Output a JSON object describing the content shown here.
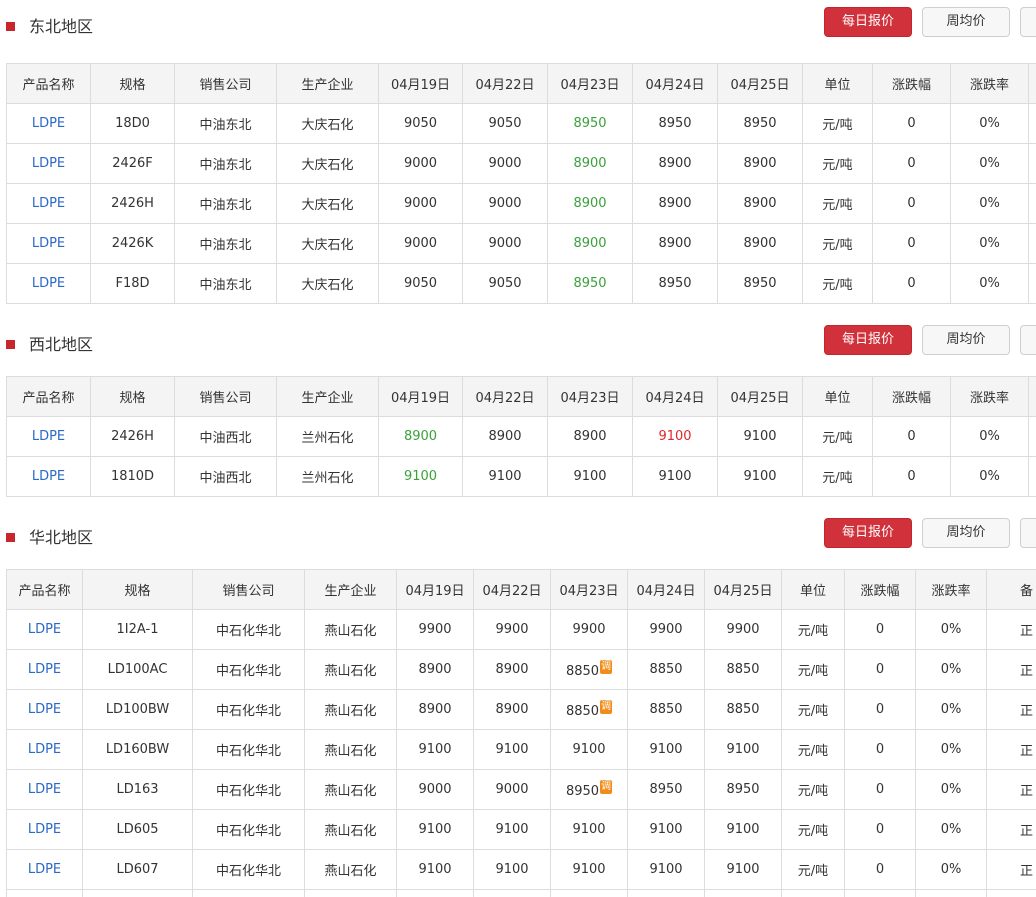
{
  "buttons": {
    "daily": "每日报价",
    "weekly": "周均价"
  },
  "colors": {
    "accent": "#c8262d",
    "link": "#2a68c9",
    "down": "#3aa13a",
    "up": "#e0272c",
    "badge": "#f08c1a"
  },
  "sections": [
    {
      "title": "东北地区",
      "headers": [
        "产品名称",
        "规格",
        "销售公司",
        "生产企业",
        "04月19日",
        "04月22日",
        "04月23日",
        "04月24日",
        "04月25日",
        "单位",
        "涨跌幅",
        "涨跌率"
      ],
      "rows": [
        [
          {
            "v": "LDPE"
          },
          {
            "v": "18D0"
          },
          {
            "v": "中油东北"
          },
          {
            "v": "大庆石化"
          },
          {
            "v": "9050"
          },
          {
            "v": "9050"
          },
          {
            "v": "8950",
            "c": "down"
          },
          {
            "v": "8950"
          },
          {
            "v": "8950"
          },
          {
            "v": "元/吨"
          },
          {
            "v": "0"
          },
          {
            "v": "0%"
          }
        ],
        [
          {
            "v": "LDPE"
          },
          {
            "v": "2426F"
          },
          {
            "v": "中油东北"
          },
          {
            "v": "大庆石化"
          },
          {
            "v": "9000"
          },
          {
            "v": "9000"
          },
          {
            "v": "8900",
            "c": "down"
          },
          {
            "v": "8900"
          },
          {
            "v": "8900"
          },
          {
            "v": "元/吨"
          },
          {
            "v": "0"
          },
          {
            "v": "0%"
          }
        ],
        [
          {
            "v": "LDPE"
          },
          {
            "v": "2426H"
          },
          {
            "v": "中油东北"
          },
          {
            "v": "大庆石化"
          },
          {
            "v": "9000"
          },
          {
            "v": "9000"
          },
          {
            "v": "8900",
            "c": "down"
          },
          {
            "v": "8900"
          },
          {
            "v": "8900"
          },
          {
            "v": "元/吨"
          },
          {
            "v": "0"
          },
          {
            "v": "0%"
          }
        ],
        [
          {
            "v": "LDPE"
          },
          {
            "v": "2426K"
          },
          {
            "v": "中油东北"
          },
          {
            "v": "大庆石化"
          },
          {
            "v": "9000"
          },
          {
            "v": "9000"
          },
          {
            "v": "8900",
            "c": "down"
          },
          {
            "v": "8900"
          },
          {
            "v": "8900"
          },
          {
            "v": "元/吨"
          },
          {
            "v": "0"
          },
          {
            "v": "0%"
          }
        ],
        [
          {
            "v": "LDPE"
          },
          {
            "v": "F18D"
          },
          {
            "v": "中油东北"
          },
          {
            "v": "大庆石化"
          },
          {
            "v": "9050"
          },
          {
            "v": "9050"
          },
          {
            "v": "8950",
            "c": "down"
          },
          {
            "v": "8950"
          },
          {
            "v": "8950"
          },
          {
            "v": "元/吨"
          },
          {
            "v": "0"
          },
          {
            "v": "0%"
          }
        ]
      ]
    },
    {
      "title": "西北地区",
      "headers": [
        "产品名称",
        "规格",
        "销售公司",
        "生产企业",
        "04月19日",
        "04月22日",
        "04月23日",
        "04月24日",
        "04月25日",
        "单位",
        "涨跌幅",
        "涨跌率"
      ],
      "rows": [
        [
          {
            "v": "LDPE"
          },
          {
            "v": "2426H"
          },
          {
            "v": "中油西北"
          },
          {
            "v": "兰州石化"
          },
          {
            "v": "8900",
            "c": "down"
          },
          {
            "v": "8900"
          },
          {
            "v": "8900"
          },
          {
            "v": "9100",
            "c": "up"
          },
          {
            "v": "9100"
          },
          {
            "v": "元/吨"
          },
          {
            "v": "0"
          },
          {
            "v": "0%"
          }
        ],
        [
          {
            "v": "LDPE"
          },
          {
            "v": "1810D"
          },
          {
            "v": "中油西北"
          },
          {
            "v": "兰州石化"
          },
          {
            "v": "9100",
            "c": "down"
          },
          {
            "v": "9100"
          },
          {
            "v": "9100"
          },
          {
            "v": "9100"
          },
          {
            "v": "9100"
          },
          {
            "v": "元/吨"
          },
          {
            "v": "0"
          },
          {
            "v": "0%"
          }
        ]
      ]
    },
    {
      "title": "华北地区",
      "headers": [
        "产品名称",
        "规格",
        "销售公司",
        "生产企业",
        "04月19日",
        "04月22日",
        "04月23日",
        "04月24日",
        "04月25日",
        "单位",
        "涨跌幅",
        "涨跌率",
        "备"
      ],
      "badge_text": "调",
      "rows": [
        [
          {
            "v": "LDPE"
          },
          {
            "v": "1I2A-1"
          },
          {
            "v": "中石化华北"
          },
          {
            "v": "燕山石化"
          },
          {
            "v": "9900"
          },
          {
            "v": "9900"
          },
          {
            "v": "9900"
          },
          {
            "v": "9900"
          },
          {
            "v": "9900"
          },
          {
            "v": "元/吨"
          },
          {
            "v": "0"
          },
          {
            "v": "0%"
          },
          {
            "v": "正"
          }
        ],
        [
          {
            "v": "LDPE"
          },
          {
            "v": "LD100AC"
          },
          {
            "v": "中石化华北"
          },
          {
            "v": "燕山石化"
          },
          {
            "v": "8900"
          },
          {
            "v": "8900"
          },
          {
            "v": "8850",
            "b": true
          },
          {
            "v": "8850"
          },
          {
            "v": "8850"
          },
          {
            "v": "元/吨"
          },
          {
            "v": "0"
          },
          {
            "v": "0%"
          },
          {
            "v": "正"
          }
        ],
        [
          {
            "v": "LDPE"
          },
          {
            "v": "LD100BW"
          },
          {
            "v": "中石化华北"
          },
          {
            "v": "燕山石化"
          },
          {
            "v": "8900"
          },
          {
            "v": "8900"
          },
          {
            "v": "8850",
            "b": true
          },
          {
            "v": "8850"
          },
          {
            "v": "8850"
          },
          {
            "v": "元/吨"
          },
          {
            "v": "0"
          },
          {
            "v": "0%"
          },
          {
            "v": "正"
          }
        ],
        [
          {
            "v": "LDPE"
          },
          {
            "v": "LD160BW"
          },
          {
            "v": "中石化华北"
          },
          {
            "v": "燕山石化"
          },
          {
            "v": "9100"
          },
          {
            "v": "9100"
          },
          {
            "v": "9100"
          },
          {
            "v": "9100"
          },
          {
            "v": "9100"
          },
          {
            "v": "元/吨"
          },
          {
            "v": "0"
          },
          {
            "v": "0%"
          },
          {
            "v": "正"
          }
        ],
        [
          {
            "v": "LDPE"
          },
          {
            "v": "LD163"
          },
          {
            "v": "中石化华北"
          },
          {
            "v": "燕山石化"
          },
          {
            "v": "9000"
          },
          {
            "v": "9000"
          },
          {
            "v": "8950",
            "b": true
          },
          {
            "v": "8950"
          },
          {
            "v": "8950"
          },
          {
            "v": "元/吨"
          },
          {
            "v": "0"
          },
          {
            "v": "0%"
          },
          {
            "v": "正"
          }
        ],
        [
          {
            "v": "LDPE"
          },
          {
            "v": "LD605"
          },
          {
            "v": "中石化华北"
          },
          {
            "v": "燕山石化"
          },
          {
            "v": "9100"
          },
          {
            "v": "9100"
          },
          {
            "v": "9100"
          },
          {
            "v": "9100"
          },
          {
            "v": "9100"
          },
          {
            "v": "元/吨"
          },
          {
            "v": "0"
          },
          {
            "v": "0%"
          },
          {
            "v": "正"
          }
        ],
        [
          {
            "v": "LDPE"
          },
          {
            "v": "LD607"
          },
          {
            "v": "中石化华北"
          },
          {
            "v": "燕山石化"
          },
          {
            "v": "9100"
          },
          {
            "v": "9100"
          },
          {
            "v": "9100"
          },
          {
            "v": "9100"
          },
          {
            "v": "9100"
          },
          {
            "v": "元/吨"
          },
          {
            "v": "0"
          },
          {
            "v": "0%"
          },
          {
            "v": "正"
          }
        ],
        [
          {
            "v": ""
          },
          {
            "v": ""
          },
          {
            "v": ""
          },
          {
            "v": ""
          },
          {
            "v": ""
          },
          {
            "v": ""
          },
          {
            "v": ""
          },
          {
            "v": ""
          },
          {
            "v": ""
          },
          {
            "v": ""
          },
          {
            "v": ""
          },
          {
            "v": ""
          },
          {
            "v": ""
          }
        ]
      ]
    }
  ]
}
